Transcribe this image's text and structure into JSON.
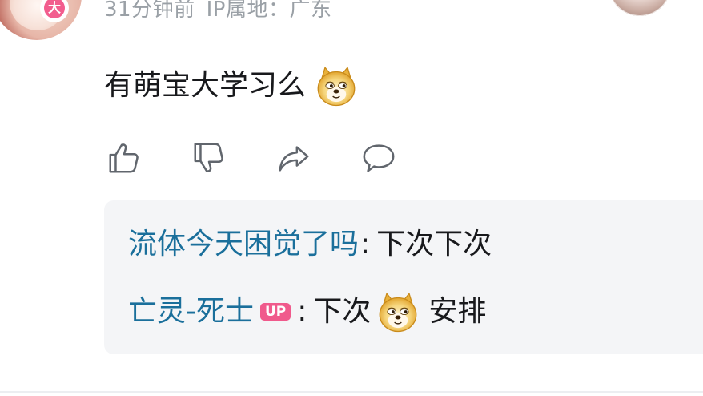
{
  "comment": {
    "time_ago": "31分钟前",
    "ip_location": "IP属地：广东",
    "text": "有萌宝大学习么",
    "emoji_icon": "doge-emoji"
  },
  "actions": {
    "like_icon": "thumbs-up-icon",
    "dislike_icon": "thumbs-down-icon",
    "share_icon": "share-icon",
    "reply_icon": "comment-bubble-icon"
  },
  "replies": [
    {
      "username": "流体今天困觉了吗",
      "colon": ":",
      "text": "下次下次"
    },
    {
      "username": "亡灵-死士",
      "badge": "UP",
      "colon": ":",
      "text_before_emoji": "下次",
      "text_after_emoji": "安排",
      "emoji_icon": "doge-emoji"
    }
  ],
  "avatar_badge_glyph": "大",
  "colors": {
    "username": "#1a6f9b",
    "meta": "#9aa0a6",
    "text": "#18191c",
    "badge": "#f05a8c",
    "reply_bg": "#f4f5f7"
  }
}
